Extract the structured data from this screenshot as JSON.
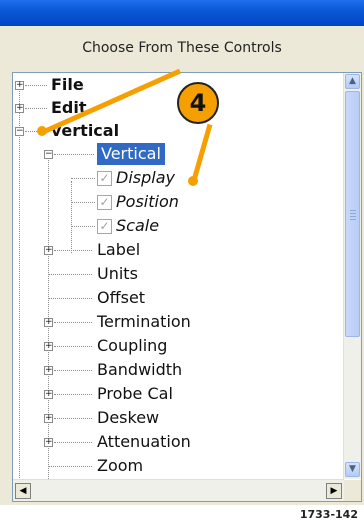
{
  "heading": "Choose From These Controls",
  "figure_id": "1733-142",
  "callout_number": "4",
  "tree": {
    "file": "File",
    "edit": "Edit",
    "vertical_root": "vertical",
    "vertical_node": "Vertical",
    "display": "Display",
    "position": "Position",
    "scale": "Scale",
    "label": "Label",
    "units": "Units",
    "offset": "Offset",
    "termination": "Termination",
    "coupling": "Coupling",
    "bandwidth": "Bandwidth",
    "probe_cal": "Probe Cal",
    "deskew": "Deskew",
    "attenuation": "Attenuation",
    "zoom": "Zoom"
  },
  "colors": {
    "titlebar": "#0a58d6",
    "selection": "#316ac5",
    "callout": "#f5a000",
    "panel": "#ece9d8"
  },
  "icons": {
    "expand": "plus-box",
    "collapse": "minus-box",
    "checkbox": "checkmark-box"
  }
}
